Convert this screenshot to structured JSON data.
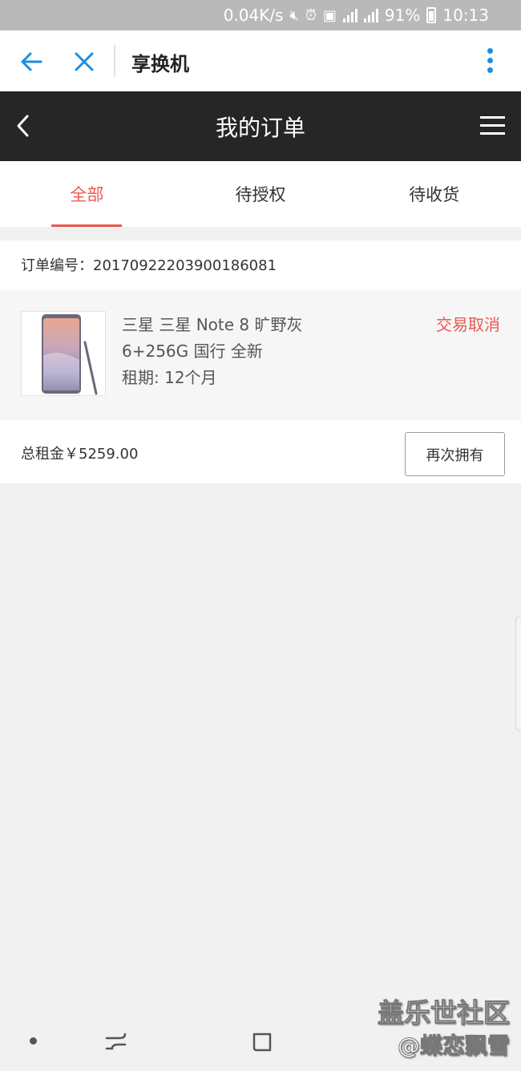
{
  "status_bar": {
    "net_speed": "0.04K/s",
    "battery": "91%",
    "time": "10:13",
    "icons": [
      "mute-icon",
      "alarm-icon",
      "sim-icon",
      "signal-2g-icon",
      "signal-4g-icon",
      "battery-icon"
    ]
  },
  "browser": {
    "title": "享换机",
    "icons": [
      "back-arrow-icon",
      "close-icon",
      "more-vert-icon"
    ],
    "accent_color": "#1a8fe0"
  },
  "header": {
    "title": "我的订单",
    "icons": [
      "chevron-left-icon",
      "menu-icon"
    ]
  },
  "tabs": [
    {
      "label": "全部",
      "active": true
    },
    {
      "label": "待授权",
      "active": false
    },
    {
      "label": "待收货",
      "active": false
    }
  ],
  "order": {
    "number_label": "订单编号：",
    "number": "20170922203900186081",
    "product_name": "三星 三星 Note 8 旷野灰",
    "product_spec": "6+256G 国行 全新",
    "lease_label": "租期:",
    "lease_value": "12个月",
    "status": "交易取消",
    "total_label": "总租金",
    "total_value": "￥5259.00",
    "again_button": "再次拥有"
  },
  "watermark": {
    "line1": "盖乐世社区",
    "line2": "@蝶恋飘雪"
  },
  "colors": {
    "accent_red": "#e85a4f",
    "header_bg": "#262626",
    "status_bar_bg": "#b9b9b9"
  }
}
